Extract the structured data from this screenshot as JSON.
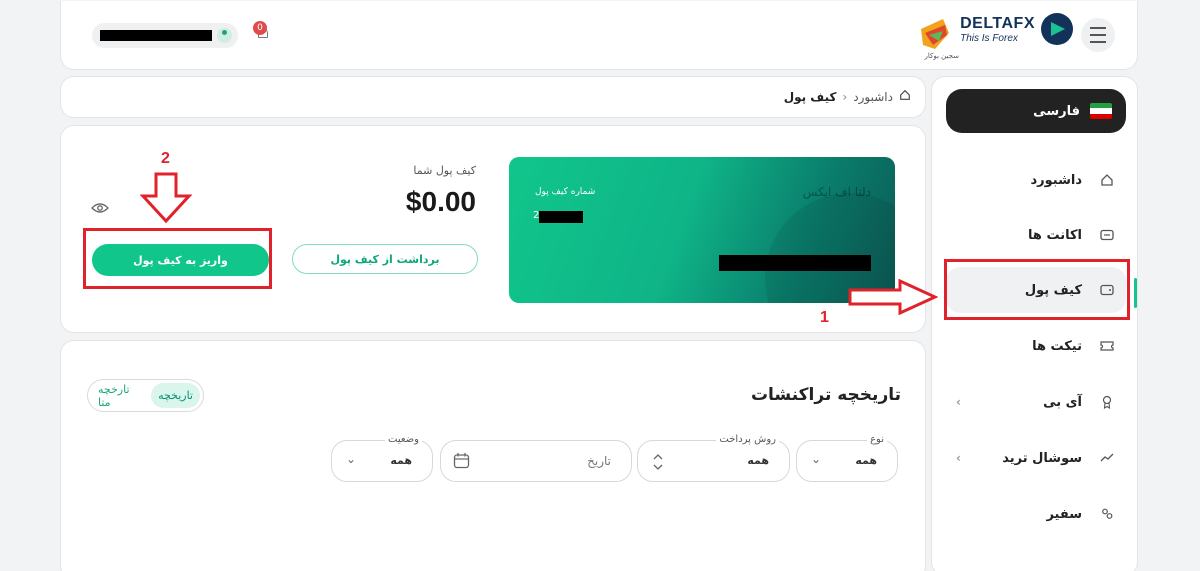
{
  "header": {
    "notification_count": "0",
    "logo_name": "DELTAFX",
    "logo_tagline": "This Is Forex",
    "partner_text": "سجین بوکار"
  },
  "sidebar": {
    "language": "فارسی",
    "items": [
      {
        "label": "داشبورد",
        "icon": "home-icon"
      },
      {
        "label": "اکانت ها",
        "icon": "account-icon"
      },
      {
        "label": "کیف پول",
        "icon": "wallet-icon",
        "active": true
      },
      {
        "label": "تیکت ها",
        "icon": "ticket-icon"
      },
      {
        "label": "آی بی",
        "icon": "award-icon",
        "expandable": true
      },
      {
        "label": "سوشال ترید",
        "icon": "trend-icon",
        "expandable": true
      },
      {
        "label": "سفیر",
        "icon": "users-icon"
      }
    ]
  },
  "breadcrumb": {
    "home": "داشبورد",
    "separator": "›",
    "current": "کیف پول"
  },
  "wallet": {
    "card_brand": "دلتا اف ایکس",
    "card_label": "شماره کیف پول",
    "card_number_lead": "2",
    "balance_label": "کیف پول شما",
    "balance": "$0.00",
    "withdraw_label": "برداشت از کیف پول",
    "deposit_label": "واریز به کیف پول"
  },
  "annotations": {
    "step1": "1",
    "step2": "2",
    "color": "#e0222b"
  },
  "transactions": {
    "title": "تاریخچه تراکنشات",
    "toggle": {
      "active": "تاریخچه",
      "inactive": "تارخچه متا"
    },
    "filters": {
      "type": {
        "label": "نوع",
        "value": "همه"
      },
      "payment_method": {
        "label": "روش پرداخت",
        "value": "همه"
      },
      "date": {
        "placeholder": "تاریخ"
      },
      "status": {
        "label": "وضعیت",
        "value": "همه"
      }
    }
  },
  "colors": {
    "accent": "#10c68b",
    "annotation_red": "#e0222b",
    "dark": "#222222"
  }
}
